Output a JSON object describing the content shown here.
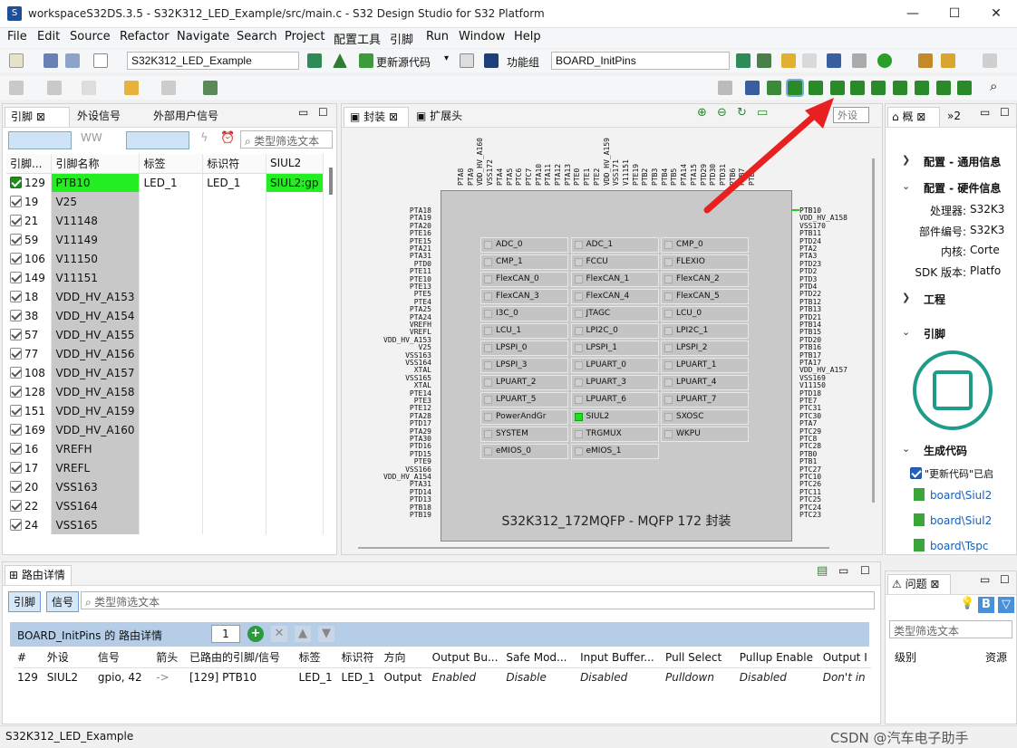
{
  "window": {
    "title": "workspaceS32DS.3.5 - S32K312_LED_Example/src/main.c - S32 Design Studio for S32 Platform",
    "min": "—",
    "max": "☐",
    "close": "✕"
  },
  "menu": [
    "File",
    "Edit",
    "Source",
    "Refactor",
    "Navigate",
    "Search",
    "Project",
    "配置工具",
    "引脚",
    "Run",
    "Window",
    "Help"
  ],
  "toolbar": {
    "project": "S32K312_LED_Example",
    "update_code": "更新源代码",
    "func_group_label": "功能组",
    "func_group": "BOARD_InitPins"
  },
  "pins_panel": {
    "tabs": [
      "引脚",
      "外设信号",
      "外部用户信号"
    ],
    "filter_placeholder": "类型筛选文本",
    "columns": [
      "引脚...",
      "引脚名称",
      "标签",
      "标识符",
      "SIUL2"
    ],
    "rows": [
      {
        "n": "129",
        "name": "PTB10",
        "label": "LED_1",
        "id": "LED_1",
        "siul": "SIUL2:gp",
        "on": true
      },
      {
        "n": "19",
        "name": "V25"
      },
      {
        "n": "21",
        "name": "V11148"
      },
      {
        "n": "59",
        "name": "V11149"
      },
      {
        "n": "106",
        "name": "V11150"
      },
      {
        "n": "149",
        "name": "V11151"
      },
      {
        "n": "18",
        "name": "VDD_HV_A153"
      },
      {
        "n": "38",
        "name": "VDD_HV_A154"
      },
      {
        "n": "57",
        "name": "VDD_HV_A155"
      },
      {
        "n": "77",
        "name": "VDD_HV_A156"
      },
      {
        "n": "108",
        "name": "VDD_HV_A157"
      },
      {
        "n": "128",
        "name": "VDD_HV_A158"
      },
      {
        "n": "151",
        "name": "VDD_HV_A159"
      },
      {
        "n": "169",
        "name": "VDD_HV_A160"
      },
      {
        "n": "16",
        "name": "VREFH"
      },
      {
        "n": "17",
        "name": "VREFL"
      },
      {
        "n": "20",
        "name": "VSS163"
      },
      {
        "n": "22",
        "name": "VSS164"
      },
      {
        "n": "24",
        "name": "VSS165"
      }
    ]
  },
  "package_panel": {
    "tabs": [
      "封装",
      "扩展头"
    ],
    "chip_title": "S32K312_172MQFP - MQFP 172 封装",
    "tooltip": "外设",
    "peripherals": [
      [
        "ADC_0",
        "ADC_1",
        "CMP_0"
      ],
      [
        "CMP_1",
        "FCCU",
        "FLEXIO"
      ],
      [
        "FlexCAN_0",
        "FlexCAN_1",
        "FlexCAN_2"
      ],
      [
        "FlexCAN_3",
        "FlexCAN_4",
        "FlexCAN_5"
      ],
      [
        "I3C_0",
        "JTAGC",
        "LCU_0"
      ],
      [
        "LCU_1",
        "LPI2C_0",
        "LPI2C_1"
      ],
      [
        "LPSPI_0",
        "LPSPI_1",
        "LPSPI_2"
      ],
      [
        "LPSPI_3",
        "LPUART_0",
        "LPUART_1"
      ],
      [
        "LPUART_2",
        "LPUART_3",
        "LPUART_4"
      ],
      [
        "LPUART_5",
        "LPUART_6",
        "LPUART_7"
      ],
      [
        "PowerAndGr",
        "SIUL2",
        "SXOSC"
      ],
      [
        "SYSTEM",
        "TRGMUX",
        "WKPU"
      ],
      [
        "eMIOS_0",
        "eMIOS_1",
        ""
      ]
    ],
    "left_pins": [
      "PTA18",
      "PTA19",
      "PTA20",
      "PTE16",
      "PTE15",
      "PTA21",
      "PTA31",
      "PTD0",
      "PTE11",
      "PTE10",
      "PTE13",
      "PTE5",
      "PTE4",
      "PTA25",
      "PTA24",
      "VREFH",
      "VREFL",
      "VDD_HV_A153",
      "V25",
      "VSS163",
      "VSS164",
      "XTAL",
      "VSS165",
      "XTAL",
      "PTE14",
      "PTE3",
      "PTE12",
      "PTA28",
      "PTD17",
      "PTA29",
      "PTA30",
      "PTD16",
      "PTD15",
      "PTE9",
      "VSS166",
      "VDD_HV_A154",
      "PTA31",
      "PTD14",
      "PTD13",
      "PTB18",
      "PTB19"
    ],
    "right_pins": [
      "PTB10",
      "VDD_HV_A158",
      "VSS170",
      "PTB11",
      "PTD24",
      "PTA2",
      "PTA3",
      "PTD23",
      "PTD2",
      "PTD3",
      "PTD4",
      "PTD22",
      "PTB12",
      "PTB13",
      "PTD21",
      "PTB14",
      "PTB15",
      "PTD20",
      "PTB16",
      "PTB17",
      "PTA17",
      "VDD_HV_A157",
      "VSS169",
      "V11150",
      "PTD18",
      "PTE7",
      "PTC31",
      "PTC30",
      "PTA7",
      "PTC29",
      "PTC8",
      "PTC28",
      "PTB0",
      "PTB1",
      "PTC27",
      "PTC10",
      "PTC26",
      "PTC11",
      "PTC25",
      "PTC24",
      "PTC23"
    ],
    "top_pins": [
      "PTA8",
      "PTA9",
      "VDD_HV_A160",
      "VSS172",
      "PTA4",
      "PTA5",
      "PTC6",
      "PTC7",
      "PTA10",
      "PTA11",
      "PTA12",
      "PTA13",
      "PTE0",
      "PTE1",
      "PTE2",
      "VDD_HV_A159",
      "VSS171",
      "V11151",
      "PTE19",
      "PTB2",
      "PTB3",
      "PTB4",
      "PTB5",
      "PTA14",
      "PTA15",
      "PTD29",
      "PTD30",
      "PTD31",
      "PTB6",
      "PTB7",
      "PTB8"
    ]
  },
  "overview_panel": {
    "tabs": [
      "概",
      "2"
    ],
    "sections": [
      {
        "title": "配置 - 通用信息"
      },
      {
        "title": "配置 - 硬件信息"
      }
    ],
    "hw": [
      {
        "k": "处理器:",
        "v": "S32K3"
      },
      {
        "k": "部件编号:",
        "v": "S32K3"
      },
      {
        "k": "内核:",
        "v": "Corte"
      },
      {
        "k": "SDK 版本:",
        "v": "Platfo"
      }
    ],
    "project": "工程",
    "pins": "引脚",
    "gen": "生成代码",
    "gen_check": "\"更新代码\"已启",
    "files": [
      "board\\Siul2",
      "board\\Siul2",
      "board\\Tspc"
    ]
  },
  "routing": {
    "tab": "路由详情",
    "btn_pins": "引脚",
    "btn_signals": "信号",
    "filter_placeholder": "类型筛选文本",
    "header": "BOARD_InitPins 的 路由详情",
    "count": "1",
    "columns": [
      "#",
      "外设",
      "信号",
      "箭头",
      "已路由的引脚/信号",
      "标签",
      "标识符",
      "方向",
      "Output Bu...",
      "Safe Mod...",
      "Input Buffer...",
      "Pull Select",
      "Pullup Enable",
      "Output I"
    ],
    "row": [
      "129",
      "SIUL2",
      "gpio, 42",
      "->",
      "[129] PTB10",
      "LED_1",
      "LED_1",
      "Output",
      "Enabled",
      "Disable",
      "Disabled",
      "Pulldown",
      "Disabled",
      "Don't in"
    ]
  },
  "problems": {
    "tab": "问题",
    "filter_placeholder": "类型筛选文本",
    "col1": "级别",
    "col2": "资源"
  },
  "status": {
    "left": "S32K312_LED_Example",
    "watermark": "CSDN @汽车电子助手"
  }
}
